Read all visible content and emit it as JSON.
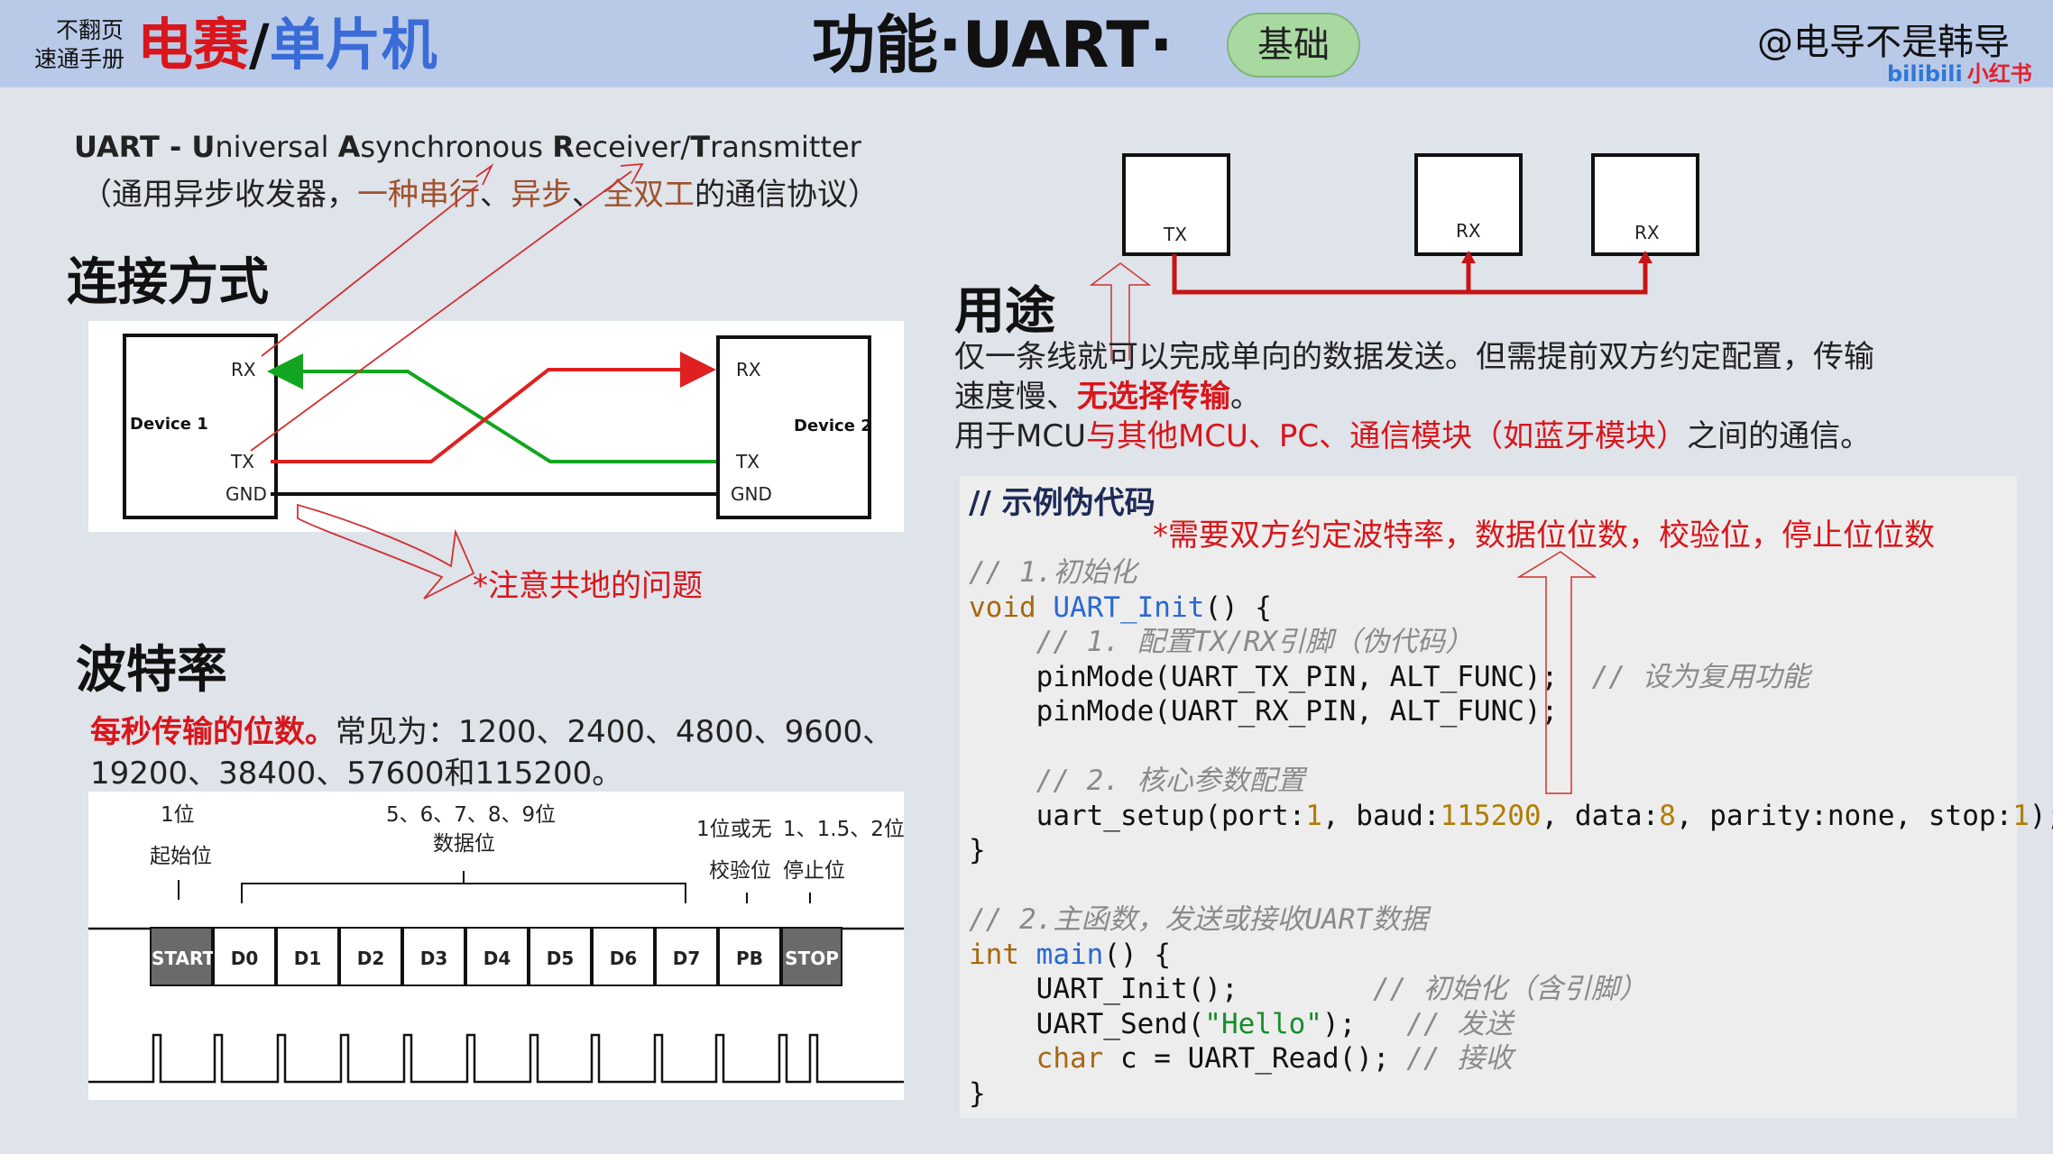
{
  "header": {
    "slogan_line1": "不翻页",
    "slogan_line2": "速通手册",
    "brand_red": "电赛",
    "brand_sep": "/",
    "brand_blue": "单片机",
    "title": "功能·UART·",
    "badge": "基础",
    "author": "@电导不是韩导",
    "platform1": "bilibili",
    "platform2": "小红书"
  },
  "intro": {
    "acronym_parts": [
      "UART - ",
      "U",
      "niversal ",
      "A",
      "synchronous ",
      "R",
      "eceiver/",
      "T",
      "ransmitter"
    ],
    "desc_parts": [
      "（通用异步收发器，",
      "一种串行",
      "、",
      "异步",
      "、",
      "全双工",
      "的通信协议）"
    ]
  },
  "connection": {
    "heading": "连接方式",
    "device1": "Device 1",
    "device2": "Device 2",
    "rx": "RX",
    "tx": "TX",
    "gnd": "GND",
    "note": "*注意共地的问题"
  },
  "usage": {
    "heading": "用途",
    "tx_label": "TX",
    "rx_label1": "RX",
    "rx_label2": "RX",
    "line1": "仅一条线就可以完成单向的数据发送。但需提前双方约定配置，传输",
    "line2_a": "速度慢、",
    "line2_b": "无选择传输",
    "line2_c": "。",
    "line3_a": "用于MCU",
    "line3_b": "与其他MCU、PC、通信模块（如蓝牙模块）",
    "line3_c": "之间的通信。"
  },
  "baud": {
    "heading": "波特率",
    "line1_a": "每秒传输的位数。",
    "line1_b": "常见为：1200、2400、4800、9600、",
    "line2": "19200、38400、57600和115200。",
    "lbl_1bit": "1位",
    "lbl_start_cn": "起始位",
    "lbl_data_bits": "5、6、7、8、9位",
    "lbl_data_cn": "数据位",
    "lbl_parity_bits": "1位或无",
    "lbl_stop_bits": "1、1.5、2位",
    "lbl_parity_cn": "校验位",
    "lbl_stop_cn": "停止位",
    "frame": [
      "START",
      "D0",
      "D1",
      "D2",
      "D3",
      "D4",
      "D5",
      "D6",
      "D7",
      "PB",
      "STOP"
    ]
  },
  "code": {
    "title": "// 示例伪代码",
    "note": "*需要双方约定波特率，数据位位数，校验位，停止位位数",
    "c1": "// 1.初始化",
    "l_void": "void",
    "l_init_fn": "UART_Init",
    "l_init_rest": "() {",
    "c2": "// 1. 配置TX/RX引脚（伪代码）",
    "l_pin_tx": "pinMode(UART_TX_PIN, ALT_FUNC);",
    "c_alt": "// 设为复用功能",
    "l_pin_rx": "pinMode(UART_RX_PIN, ALT_FUNC);",
    "c3": "// 2. 核心参数配置",
    "s_a": "uart_setup(port:",
    "s_port": "1",
    "s_b": ", baud:",
    "s_baud": "115200",
    "s_c": ", data:",
    "s_data": "8",
    "s_d": ", parity:none, stop:",
    "s_stop": "1",
    "s_e": ");",
    "close1": "}",
    "c4": "// 2.主函数，发送或接收UART数据",
    "l_int": "int",
    "l_main": "main",
    "l_main_rest": "() {",
    "call_init": "UART_Init();",
    "c_init": "// 初始化（含引脚）",
    "send_a": "UART_Send(",
    "send_str": "\"Hello\"",
    "send_b": ");",
    "c_send": "// 发送",
    "l_char": "char",
    "read_rest": " c = UART_Read();",
    "c_read": "// 接收",
    "close2": "}"
  }
}
